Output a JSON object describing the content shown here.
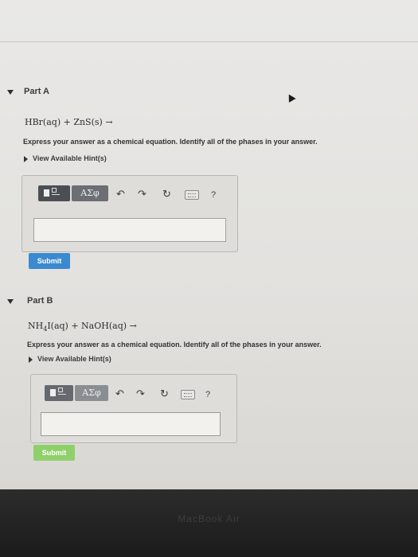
{
  "colors": {
    "submit_active": "#3b8ad0",
    "submit_dim": "#8fd06c",
    "toolbar_dark": "#4b4f54",
    "symbol_button": "#6b6f74"
  },
  "part_a": {
    "title": "Part A",
    "equation": "HBr(aq) + ZnS(s) →",
    "instruction": "Express your answer as a chemical equation. Identify all of the phases in your answer.",
    "hints_label": "View Available Hint(s)",
    "toolbar": {
      "template_icon": "template-icon",
      "symbols_label": "ΑΣφ",
      "undo_icon": "↶",
      "redo_icon": "↷",
      "reset_icon": "↻",
      "keyboard_icon": "keyboard-icon",
      "help_label": "?"
    },
    "answer_value": "",
    "submit_label": "Submit"
  },
  "part_b": {
    "title": "Part B",
    "equation_prefix": "NH",
    "equation_subscript": "4",
    "equation_suffix": "I(aq) + NaOH(aq) →",
    "instruction": "Express your answer as a chemical equation. Identify all of the phases in your answer.",
    "hints_label": "View Available Hint(s)",
    "toolbar": {
      "template_icon": "template-icon",
      "symbols_label": "ΑΣφ",
      "undo_icon": "↶",
      "redo_icon": "↷",
      "reset_icon": "↻",
      "keyboard_icon": "keyboard-icon",
      "help_label": "?"
    },
    "answer_value": "",
    "submit_label": "Submit"
  },
  "bezel_label": "MacBook Air"
}
